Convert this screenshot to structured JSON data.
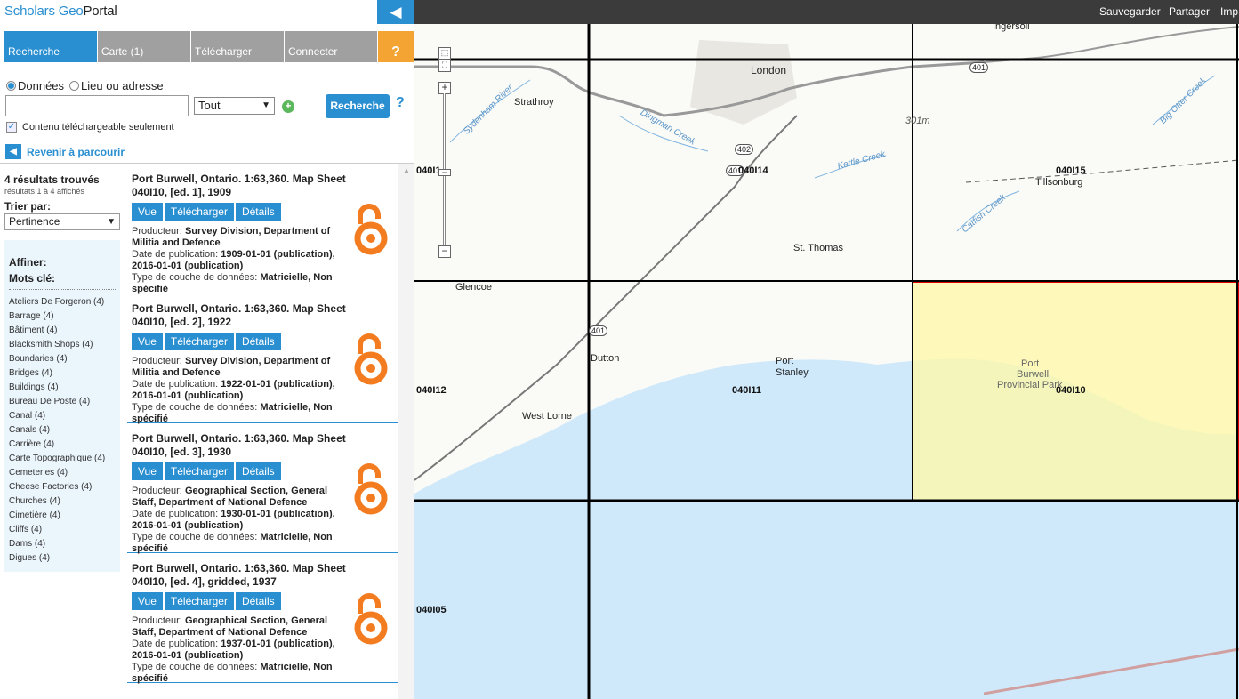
{
  "app": {
    "logo_a": "Scholars Geo",
    "logo_b": "Portal",
    "collapse_icon": "◀"
  },
  "tabs": [
    {
      "label": "Recherche",
      "active": true
    },
    {
      "label": "Carte (1)"
    },
    {
      "label": "Télécharger"
    },
    {
      "label": "Connecter"
    },
    {
      "label": "?"
    }
  ],
  "search": {
    "radio_data": "Données",
    "radio_place": "Lieu ou adresse",
    "query_value": "",
    "type_select": "Tout",
    "button": "Recherche",
    "help": "?",
    "download_only": "Contenu téléchargeable seulement",
    "back_label": "Revenir à parcourir"
  },
  "results": {
    "count": "4 résultats trouvés",
    "shown": "résultats 1 à 4 affichés",
    "sort_label": "Trier par:",
    "sort_value": "Pertinence",
    "items": [
      {
        "title": "Port Burwell, Ontario. 1:63,360. Map Sheet 040I10, [ed. 1], 1909",
        "producer_label": "Producteur:",
        "producer": "Survey Division, Department of Militia and Defence",
        "date_label": "Date de publication:",
        "date": "1909-01-01 (publication), 2016-01-01 (publication)",
        "type_label": "Type de couche de données:",
        "type": "Matricielle, Non spécifié"
      },
      {
        "title": "Port Burwell, Ontario. 1:63,360. Map Sheet 040I10, [ed. 2], 1922",
        "producer_label": "Producteur:",
        "producer": "Survey Division, Department of Militia and Defence",
        "date_label": "Date de publication:",
        "date": "1922-01-01 (publication), 2016-01-01 (publication)",
        "type_label": "Type de couche de données:",
        "type": "Matricielle, Non spécifié"
      },
      {
        "title": "Port Burwell, Ontario. 1:63,360. Map Sheet 040I10, [ed. 3], 1930",
        "producer_label": "Producteur:",
        "producer": "Geographical Section, General Staff, Department of National Defence",
        "date_label": "Date de publication:",
        "date": "1930-01-01 (publication), 2016-01-01 (publication)",
        "type_label": "Type de couche de données:",
        "type": "Matricielle, Non spécifié"
      },
      {
        "title": "Port Burwell, Ontario. 1:63,360. Map Sheet 040I10, [ed. 4], gridded, 1937",
        "producer_label": "Producteur:",
        "producer": "Geographical Section, General Staff, Department of National Defence",
        "date_label": "Date de publication:",
        "date": "1937-01-01 (publication), 2016-01-01 (publication)",
        "type_label": "Type de couche de données:",
        "type": "Matricielle, Non spécifié"
      }
    ],
    "btn_view": "Vue",
    "btn_download": "Télécharger",
    "btn_details": "Détails"
  },
  "facets": {
    "refine": "Affiner:",
    "keywords_label": "Mots clé:",
    "keywords": [
      "Ateliers De Forgeron (4)",
      "Barrage (4)",
      "Bâtiment (4)",
      "Blacksmith Shops (4)",
      "Boundaries (4)",
      "Bridges (4)",
      "Buildings (4)",
      "Bureau De Poste (4)",
      "Canal (4)",
      "Canals (4)",
      "Carrière (4)",
      "Carte Topographique (4)",
      "Cemeteries (4)",
      "Cheese Factories (4)",
      "Churches (4)",
      "Cimetière (4)",
      "Cliffs (4)",
      "Dams (4)",
      "Digues (4)"
    ]
  },
  "map": {
    "toolbar": {
      "save": "Sauvegarder",
      "share": "Partager",
      "print": "Imp"
    },
    "places": [
      "Ingersoll",
      "London",
      "Strathroy",
      "Tillsonburg",
      "St. Thomas",
      "Glencoe",
      "Dutton",
      "Port",
      "Stanley",
      "West Lorne",
      "Port",
      "Burwell",
      "Provincial Park",
      "301m"
    ],
    "rivers": [
      "Sydenham River",
      "Dingman Creek",
      "Kettle Creek",
      "Catfish Creek",
      "Big Otter Creek"
    ],
    "roads": [
      "401",
      "402",
      "401",
      "401"
    ],
    "tiles": [
      "040I14",
      "040I15",
      "040I11",
      "040I10",
      "040I12",
      "040I05",
      "040I1"
    ],
    "colors": {
      "water": "#cfe9fb",
      "land": "#ffffff",
      "selected": "#fff8a6",
      "selected_border": "#e00000",
      "grid": "#000000"
    }
  }
}
